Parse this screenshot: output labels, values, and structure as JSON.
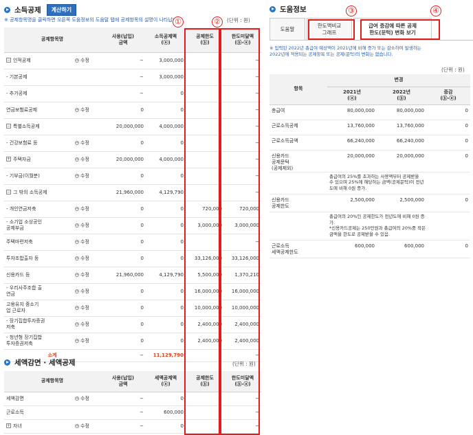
{
  "income": {
    "title": "소득공제",
    "calc_button": "계산하기",
    "note": "※ 공제항목명을 클릭하면 오른쪽 도움정보의 도움말 탭에 공제항목의 설명이 나타납니다.",
    "unit": "(단위 : 원)",
    "headers": [
      "공제항목명",
      "",
      "사용(납입)\n금액",
      "소득공제액\n(ⓐ)",
      "공제한도\n(ⓑ)",
      "한도미달액\n(ⓑ-ⓐ)"
    ],
    "rows": [
      {
        "name": "인적공제",
        "prefix": "−",
        "edit": "수정",
        "used": "−",
        "ded": "3,000,000",
        "limit": "−",
        "under": "−"
      },
      {
        "name": "- 기본공제",
        "prefix": "",
        "edit": "",
        "used": "−",
        "ded": "3,000,000",
        "limit": "−",
        "under": "−"
      },
      {
        "name": "- 추가공제",
        "prefix": "",
        "edit": "",
        "used": "−",
        "ded": "0",
        "limit": "−",
        "under": "−"
      },
      {
        "name": "연금보험료공제",
        "prefix": "",
        "edit": "수정",
        "used": "0",
        "ded": "0",
        "limit": "−",
        "under": "−"
      },
      {
        "name": "특별소득공제",
        "prefix": "−",
        "edit": "",
        "used": "20,000,000",
        "ded": "4,000,000",
        "limit": "−",
        "under": "−"
      },
      {
        "name": "- 건강보험료 등",
        "prefix": "",
        "edit": "수정",
        "used": "0",
        "ded": "0",
        "limit": "−",
        "under": "−"
      },
      {
        "name": "주택자금",
        "prefix": "+",
        "edit": "수정",
        "used": "20,000,000",
        "ded": "4,000,000",
        "limit": "−",
        "under": "−"
      },
      {
        "name": "- 기부금(이월분)",
        "prefix": "",
        "edit": "수정",
        "used": "0",
        "ded": "0",
        "limit": "−",
        "under": "−"
      },
      {
        "name": "그 밖의 소득공제",
        "prefix": "−",
        "edit": "",
        "used": "21,960,000",
        "ded": "4,129,790",
        "limit": "−",
        "under": "−"
      },
      {
        "name": "- 개인연금저축",
        "prefix": "",
        "edit": "수정",
        "used": "0",
        "ded": "0",
        "limit": "720,000",
        "under": "720,000"
      },
      {
        "name": "- 소기업 소상공인\n공제부금",
        "prefix": "",
        "edit": "수정",
        "used": "0",
        "ded": "0",
        "limit": "3,000,000",
        "under": "3,000,000"
      },
      {
        "name": "주택마련저축",
        "prefix": "",
        "edit": "수정",
        "used": "0",
        "ded": "0",
        "limit": "−",
        "under": "−"
      },
      {
        "name": "투자조합출자 등",
        "prefix": "",
        "edit": "수정",
        "used": "0",
        "ded": "0",
        "limit": "33,126,000",
        "under": "33,126,000"
      },
      {
        "name": "신용카드 등",
        "prefix": "",
        "edit": "수정",
        "used": "21,960,000",
        "ded": "4,129,790",
        "limit": "5,500,000",
        "under": "1,370,210"
      },
      {
        "name": "- 우리사주조합 출\n연금",
        "prefix": "",
        "edit": "수정",
        "used": "0",
        "ded": "0",
        "limit": "16,000,000",
        "under": "16,000,000"
      },
      {
        "name": "고용유지 중소기\n업 근로자",
        "prefix": "",
        "edit": "수정",
        "used": "0",
        "ded": "0",
        "limit": "10,000,000",
        "under": "10,000,000"
      },
      {
        "name": "- 장기집합투자증권\n저축",
        "prefix": "",
        "edit": "수정",
        "used": "0",
        "ded": "0",
        "limit": "2,400,000",
        "under": "2,400,000"
      },
      {
        "name": "- 청년형 장기집합\n투자증권저축",
        "prefix": "",
        "edit": "수정",
        "used": "0",
        "ded": "0",
        "limit": "2,400,000",
        "under": "2,400,000"
      }
    ],
    "total": {
      "name": "소계",
      "used": "−",
      "ded": "11,129,790",
      "limit": "−",
      "under": "−"
    }
  },
  "tax": {
    "title": "세액감면 · 세액공제",
    "unit": "(단위 : 원)",
    "headers": [
      "공제항목명",
      "",
      "사용(납입)\n금액",
      "세액공제액\n(ⓐ)",
      "공제한도\n(ⓑ)",
      "한도미달액\n(ⓑ-ⓐ)"
    ],
    "rows": [
      {
        "name": "세액감면",
        "prefix": "",
        "edit": "수정",
        "used": "−",
        "ded": "0",
        "limit": "−",
        "under": "−"
      },
      {
        "name": "근로소득",
        "prefix": "",
        "edit": "",
        "used": "−",
        "ded": "600,000",
        "limit": "−",
        "under": "−"
      },
      {
        "name": "자녀",
        "prefix": "+",
        "edit": "수정",
        "used": "−",
        "ded": "0",
        "limit": "−",
        "under": "−"
      }
    ]
  },
  "help": {
    "title": "도움정보",
    "tabs": [
      "도움말",
      "한도액비교\n그래프",
      "급여 증감에 따른 공제\n한도(문턱) 변화 보기"
    ],
    "note": "※ 입력된 2022년 총급여 예상액이 2021년에 비해 증가 또는 감소하여 발생하는\n2022년에 적용되는 공제항목 또는 공제(문턱)의 변화는 없습니다.",
    "unit": "(단위 : 원)",
    "header_group": "변경",
    "col_item": "항목",
    "cols": [
      "2021년\n(ⓐ)",
      "2022년\n(ⓑ)",
      "증감\n(ⓑ-ⓐ)"
    ],
    "rows": [
      {
        "item": "총급여",
        "y2021": "80,000,000",
        "y2022": "80,000,000",
        "diff": "0",
        "desc": ""
      },
      {
        "item": "근로소득공제",
        "y2021": "13,760,000",
        "y2022": "13,760,000",
        "diff": "0",
        "desc": ""
      },
      {
        "item": "근로소득금액",
        "y2021": "66,240,000",
        "y2022": "66,240,000",
        "diff": "0",
        "desc": ""
      },
      {
        "item": "신용카드\n공제문턱\n(공제제외)",
        "y2021": "20,000,000",
        "y2022": "20,000,000",
        "diff": "0",
        "desc": "총급여의 25%를 초과하는 사용액부터 공제받을\n수 있으며 25%에 해당하는 금액(공제문턱)이 전년\n도에 비해 0원 증가."
      },
      {
        "item": "신용카드\n공제한도",
        "y2021": "2,500,000",
        "y2022": "2,500,000",
        "diff": "0",
        "desc": "총급여의 20%인 공제한도가 전년도에 비해 0원 증\n가.\n*신용카드공제는 250만원과 총급여의 20%중 작은\n금액을 한도로 공제받을 수 있음."
      },
      {
        "item": "근로소득\n세액공제한도",
        "y2021": "600,000",
        "y2022": "600,000",
        "diff": "0",
        "desc": ""
      }
    ]
  },
  "markers": [
    "①",
    "②",
    "③",
    "④"
  ],
  "colors": {
    "accent": "#2a74c8",
    "highlight": "#e21b1b",
    "subtotal": "#e0401a"
  }
}
